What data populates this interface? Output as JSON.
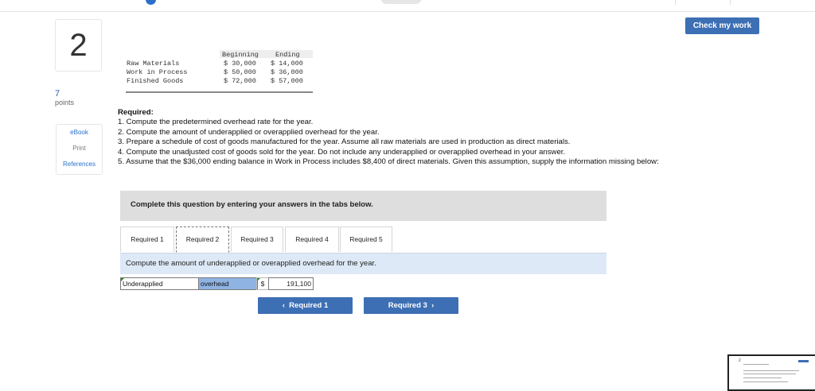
{
  "header": {
    "check_label": "Check my work"
  },
  "question": {
    "number": "2",
    "points_value": "7",
    "points_label": "points"
  },
  "side_tools": [
    "eBook",
    "Print",
    "References"
  ],
  "inventory": {
    "headers": [
      "Beginning",
      "Ending"
    ],
    "rows": [
      {
        "label": "Raw Materials",
        "beginning": "$ 30,000",
        "ending": "$ 14,000"
      },
      {
        "label": "Work in Process",
        "beginning": "$ 50,000",
        "ending": "$ 36,000"
      },
      {
        "label": "Finished Goods",
        "beginning": "$ 72,000",
        "ending": "$ 57,000"
      }
    ]
  },
  "required": {
    "title": "Required:",
    "items": [
      "1. Compute the predetermined overhead rate for the year.",
      "2. Compute the amount of underapplied or overapplied overhead for the year.",
      "3. Prepare a schedule of cost of goods manufactured for the year. Assume all raw materials are used in production as direct materials.",
      "4. Compute the unadjusted cost of goods sold for the year. Do not include any underapplied or overapplied overhead in your answer.",
      "5. Assume that the $36,000 ending balance in Work in Process includes $8,400 of direct materials. Given this assumption, supply the information missing below:"
    ]
  },
  "panel": {
    "instruction": "Complete this question by entering your answers in the tabs below."
  },
  "tabs": [
    "Required 1",
    "Required 2",
    "Required 3",
    "Required 4",
    "Required 5"
  ],
  "active_tab": 1,
  "tab_content": {
    "instruction": "Compute the amount of underapplied or overapplied overhead for the year.",
    "select1_value": "Underapplied",
    "select2_value": "overhead",
    "currency": "$",
    "amount_value": "191,100"
  },
  "navigation": {
    "prev_label": "Required 1",
    "next_label": "Required 3",
    "prev_icon": "chevron-left-icon",
    "next_icon": "chevron-right-icon"
  },
  "thumbnail": {
    "number": "2"
  },
  "colors": {
    "primary_button": "#3d6fb4",
    "instruction_bar": "#dde9f6",
    "select_highlight": "#8fb3e3"
  }
}
